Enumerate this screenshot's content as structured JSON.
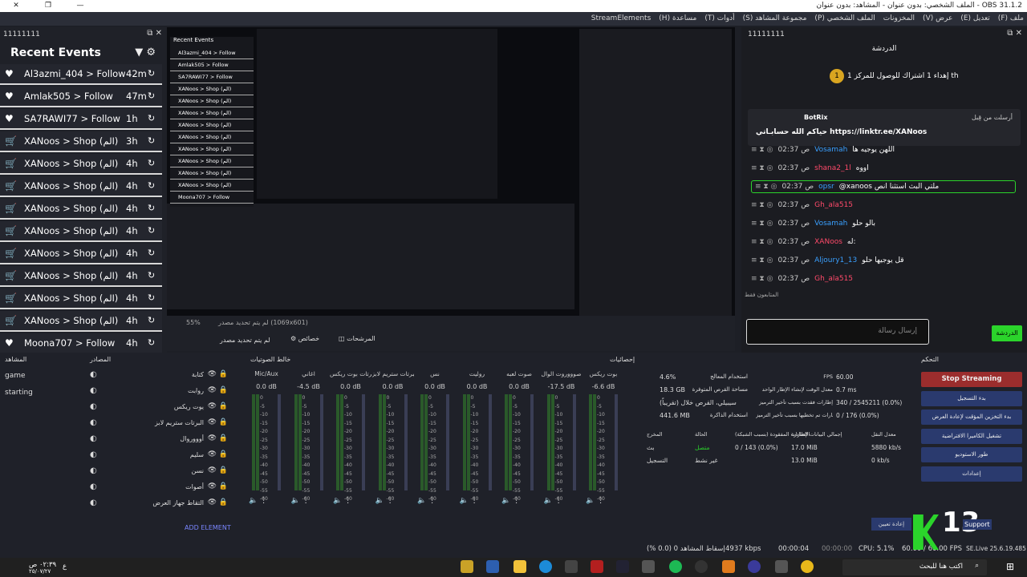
{
  "titlebar": {
    "title": "الملف الشخصي: بدون عنوان - المشاهد: بدون عنوان - OBS 31.1.2"
  },
  "menubar": [
    "ملف (F)",
    "تعديل (E)",
    "عرض (V)",
    "المخزونات",
    "الملف الشخصي (P)",
    "مجموعة المشاهد (S)",
    "أدوات (T)",
    "مساعدة (H)",
    "StreamElements"
  ],
  "recent_events": {
    "dock_title": "11111111",
    "title": "Recent Events",
    "items": [
      {
        "icon": "heart",
        "text": "Al3azmi_404 > Follow",
        "time": "42m"
      },
      {
        "icon": "heart",
        "text": "Amlak505 > Follow",
        "time": "47m"
      },
      {
        "icon": "heart",
        "text": "SA7RAWI77 > Follow",
        "time": "1h"
      },
      {
        "icon": "cart",
        "text": "XANoos > Shop (الم)",
        "time": "3h"
      },
      {
        "icon": "cart",
        "text": "XANoos > Shop (الم)",
        "time": "4h"
      },
      {
        "icon": "cart",
        "text": "XANoos > Shop (الم)",
        "time": "4h"
      },
      {
        "icon": "cart",
        "text": "XANoos > Shop (الم)",
        "time": "4h"
      },
      {
        "icon": "cart",
        "text": "XANoos > Shop (الم)",
        "time": "4h"
      },
      {
        "icon": "cart",
        "text": "XANoos > Shop (الم)",
        "time": "4h"
      },
      {
        "icon": "cart",
        "text": "XANoos > Shop (الم)",
        "time": "4h"
      },
      {
        "icon": "cart",
        "text": "XANoos > Shop (الم)",
        "time": "4h"
      },
      {
        "icon": "cart",
        "text": "XANoos > Shop (الم)",
        "time": "4h"
      },
      {
        "icon": "heart",
        "text": "Moona707 > Follow",
        "time": "4h"
      }
    ]
  },
  "preview": {
    "mini_events": [
      "Al3azmi_404 > Follow",
      "Amlak505 > Follow",
      "SA7RAWI77 > Follow",
      "XANoos > Shop (الم)",
      "XANoos > Shop (الم)",
      "XANoos > Shop (الم)",
      "XANoos > Shop (الم)",
      "XANoos > Shop (الم)",
      "XANoos > Shop (الم)",
      "XANoos > Shop (الم)",
      "XANoos > Shop (الم)",
      "XANoos > Shop (الم)",
      "Moona707 > Follow"
    ],
    "mini_events_title": "Recent Events",
    "zoom": "55%",
    "resolution": "لم يتم تحديد مصدر (1069x601)",
    "props_label": "خصائص",
    "filters_label": "المرشحات",
    "no_source": "لم يتم تحديد مصدر"
  },
  "chat": {
    "dock_title": "11111111",
    "title": "الدردشة",
    "gift_banner": "إهداء 1 اشتراك للوصول للمركز 1 th",
    "pinned_by": "أرسلت من قِبل",
    "pinned_user": "BotRix",
    "pinned_msg": "حياكم الله حسابـاتي https://linktr.ee/XANoos",
    "messages": [
      {
        "time": "02:37 ص",
        "user": "Vosamah",
        "text": "اللهن يوجيه ها"
      },
      {
        "time": "02:37 ص",
        "user": "shana2_1l",
        "text": "اووه"
      },
      {
        "time": "02:37 ص",
        "user": "opsr",
        "text": "@xanoos ملتي البث استثنا انص"
      },
      {
        "time": "02:37 ص",
        "user": "Gh_ala515",
        "text": ""
      },
      {
        "time": "02:37 ص",
        "user": "Vosamah",
        "text": "بالو حلو"
      },
      {
        "time": "02:37 ص",
        "user": "XANoos",
        "text": "له:"
      },
      {
        "time": "02:37 ص",
        "user": "Aljoury1_13",
        "text": "قل يوجيها حلو"
      },
      {
        "time": "02:37 ص",
        "user": "Gh_ala515",
        "text": ""
      }
    ],
    "viewers_label": "المتابعون فقط",
    "input_placeholder": "إرسال رسالة",
    "send_label": "الدردشة"
  },
  "scenes": {
    "title": "المشاهد",
    "items": [
      "game",
      "starting"
    ]
  },
  "sources": {
    "title": "المصادر",
    "items": [
      "كتابة",
      "روابت",
      "يوت ريكس",
      "البرتات ستريم لابز",
      "أوووروال",
      "سليم",
      "نسن",
      "أصوات",
      "التقاط جهاز العرض"
    ]
  },
  "mixer": {
    "title": "خالط الصوتيات",
    "channels": [
      {
        "name": "Mic/Aux",
        "db": "0.0 dB"
      },
      {
        "name": "اغاني",
        "db": "-4.5 dB"
      },
      {
        "name": "البرتات بوت ريكس",
        "db": "0.0 dB"
      },
      {
        "name": "البرتات ستريم لابز",
        "db": "0.0 dB"
      },
      {
        "name": "نس",
        "db": "0.0 dB"
      },
      {
        "name": "روليت",
        "db": "0.0 dB"
      },
      {
        "name": "صوت لعبه",
        "db": "0.0 dB"
      },
      {
        "name": "صوووروت الوال",
        "db": "-17.5 dB"
      },
      {
        "name": "بوت ريكس",
        "db": "-6.6 dB"
      }
    ],
    "scale": [
      "0",
      "-5",
      "-10",
      "-15",
      "-20",
      "-25",
      "-30",
      "-35",
      "-40",
      "-45",
      "-50",
      "-55",
      "-60"
    ]
  },
  "stats": {
    "title": "إحصائيات",
    "left": [
      [
        "4.6%",
        "استخدام المعالج"
      ],
      [
        "18.3 GB",
        "مساحة القرص المتوفرة"
      ],
      [
        "سيبيلي، القرص خلال (تقريباً)",
        ""
      ],
      [
        "441.6 MB",
        "استخدام الذاكرة"
      ]
    ],
    "right": [
      [
        "60.00",
        "FPS"
      ],
      [
        "0.7 ms",
        "معدل الوقت لإنشاء الإطار الواحد"
      ],
      [
        "340 / 2545211 (0.0%)",
        "إطارات فقدت بسبب تأخير الترميز"
      ],
      [
        "0 / 176 (0.0%)",
        "إطارات تم تخطيها بسبب تأخير الترميز"
      ]
    ],
    "table_head": [
      "المخرج",
      "الحالة",
      "الإطارات المفقودة (بسبب الشبكة)",
      "إجمالي البيانات الصادرة",
      "معدل النقل"
    ],
    "rows": [
      [
        "بث",
        "متصل",
        "0 / 143 (0.0%)",
        "17.0 MiB",
        "5880 kb/s"
      ],
      [
        "التسجيل",
        "غير نشط",
        "",
        "13.0 MiB",
        "0 kb/s"
      ]
    ],
    "reset": "إعادة تعيين"
  },
  "controls": {
    "title": "التحكم",
    "buttons": [
      "Stop Streaming",
      "بدء التسجيل",
      "بدء التخزين المؤقت لإعادة العرض",
      "تشغيل الكاميرا الافتراضية",
      "طور الاستوديو",
      "إعدادات"
    ]
  },
  "status": {
    "dropped": "إسقاط المشاهد 0 (0.0 %)",
    "kbps": "4937 kbps",
    "live": "00:00:04",
    "rec": "00:00:00",
    "cpu": "CPU: 5.1%",
    "fps": "60.00 / 60.00 FPS",
    "version": "SE.Live 25.6.19.485"
  },
  "taskbar": {
    "search": "اكتب هنا للبحث",
    "time": "٠٢:٣٩ ص",
    "date": "٢٥/٠٧/٢٧",
    "lang": "ع"
  },
  "overlay": {
    "k13": "13",
    "support": "Support"
  },
  "colors": {
    "accent_green": "#2bd42b",
    "stop_red": "#9b2d2d",
    "blue_btn": "#2a3a6e"
  }
}
